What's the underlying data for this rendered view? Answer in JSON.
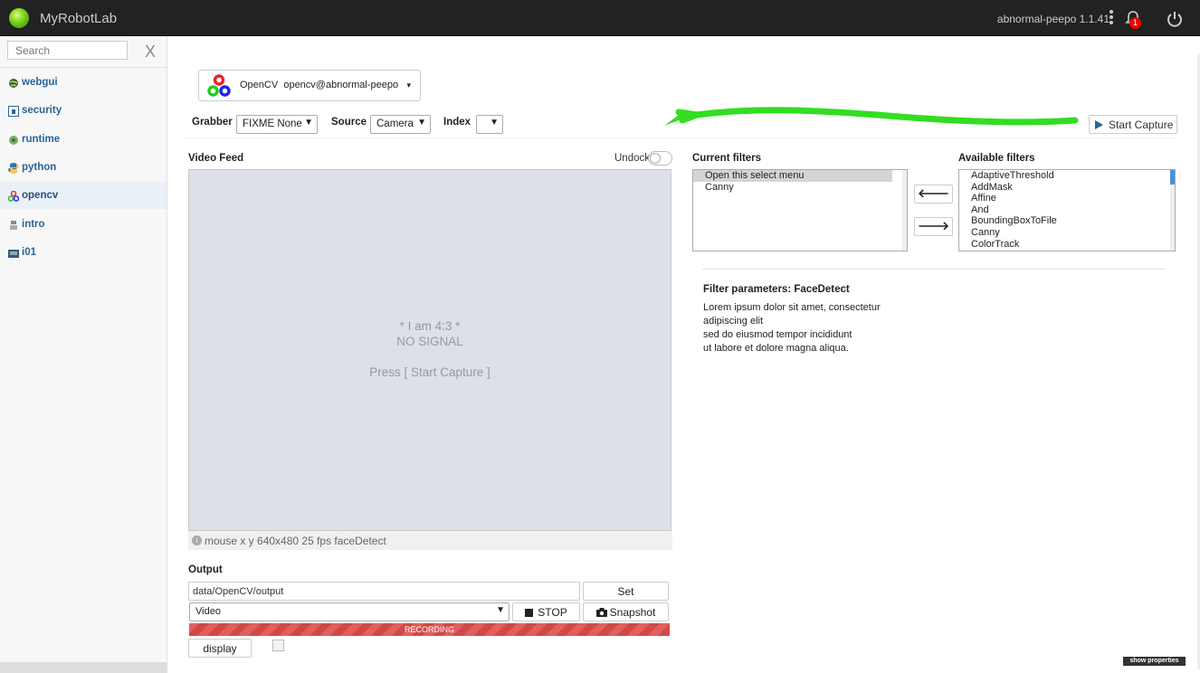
{
  "app": {
    "title": "MyRobotLab",
    "host_version": "abnormal-peepo 1.1.41",
    "notification_count": "1"
  },
  "sidebar": {
    "search_placeholder": "Search",
    "clear_label": "X",
    "items": [
      {
        "label": "webgui"
      },
      {
        "label": "security"
      },
      {
        "label": "runtime"
      },
      {
        "label": "python"
      },
      {
        "label": "opencv"
      },
      {
        "label": "intro"
      },
      {
        "label": "i01"
      }
    ]
  },
  "service": {
    "type": "OpenCV",
    "name": "opencv@abnormal-peepo"
  },
  "controls": {
    "grabber_label": "Grabber",
    "grabber_value": "FIXME None",
    "source_label": "Source",
    "source_value": "Camera",
    "index_label": "Index",
    "index_value": "",
    "start_capture": "Start Capture"
  },
  "video": {
    "title": "Video Feed",
    "undock": "Undock",
    "line1": "* I am 4:3 *",
    "line2": "NO SIGNAL",
    "line3": "Press [ Start Capture ]",
    "status": "mouse x y 640x480 25 fps faceDetect"
  },
  "output": {
    "title": "Output",
    "path": "data/OpenCV/output",
    "set_label": "Set",
    "format": "Video",
    "stop_label": "STOP",
    "snapshot_label": "Snapshot",
    "recording_label": "RECORDING",
    "display_label": "display"
  },
  "filters": {
    "current_title": "Current filters",
    "current": [
      "Open this select menu",
      "Canny"
    ],
    "available_title": "Available filters",
    "available": [
      "AdaptiveThreshold",
      "AddMask",
      "Affine",
      "And",
      "BoundingBoxToFile",
      "Canny",
      "ColorTrack"
    ],
    "params_title": "Filter parameters: FaceDetect",
    "params_text": [
      "Lorem ipsum dolor sit amet, consectetur",
      "adipiscing elit",
      "sed do eiusmod tempor incididunt",
      "ut labore et dolore magna aliqua."
    ]
  },
  "footer": {
    "show_properties": "show properties"
  },
  "colors": {
    "accent": "#2a6496",
    "annotation_arrow": "#33dd22",
    "recording": "#e06060"
  }
}
